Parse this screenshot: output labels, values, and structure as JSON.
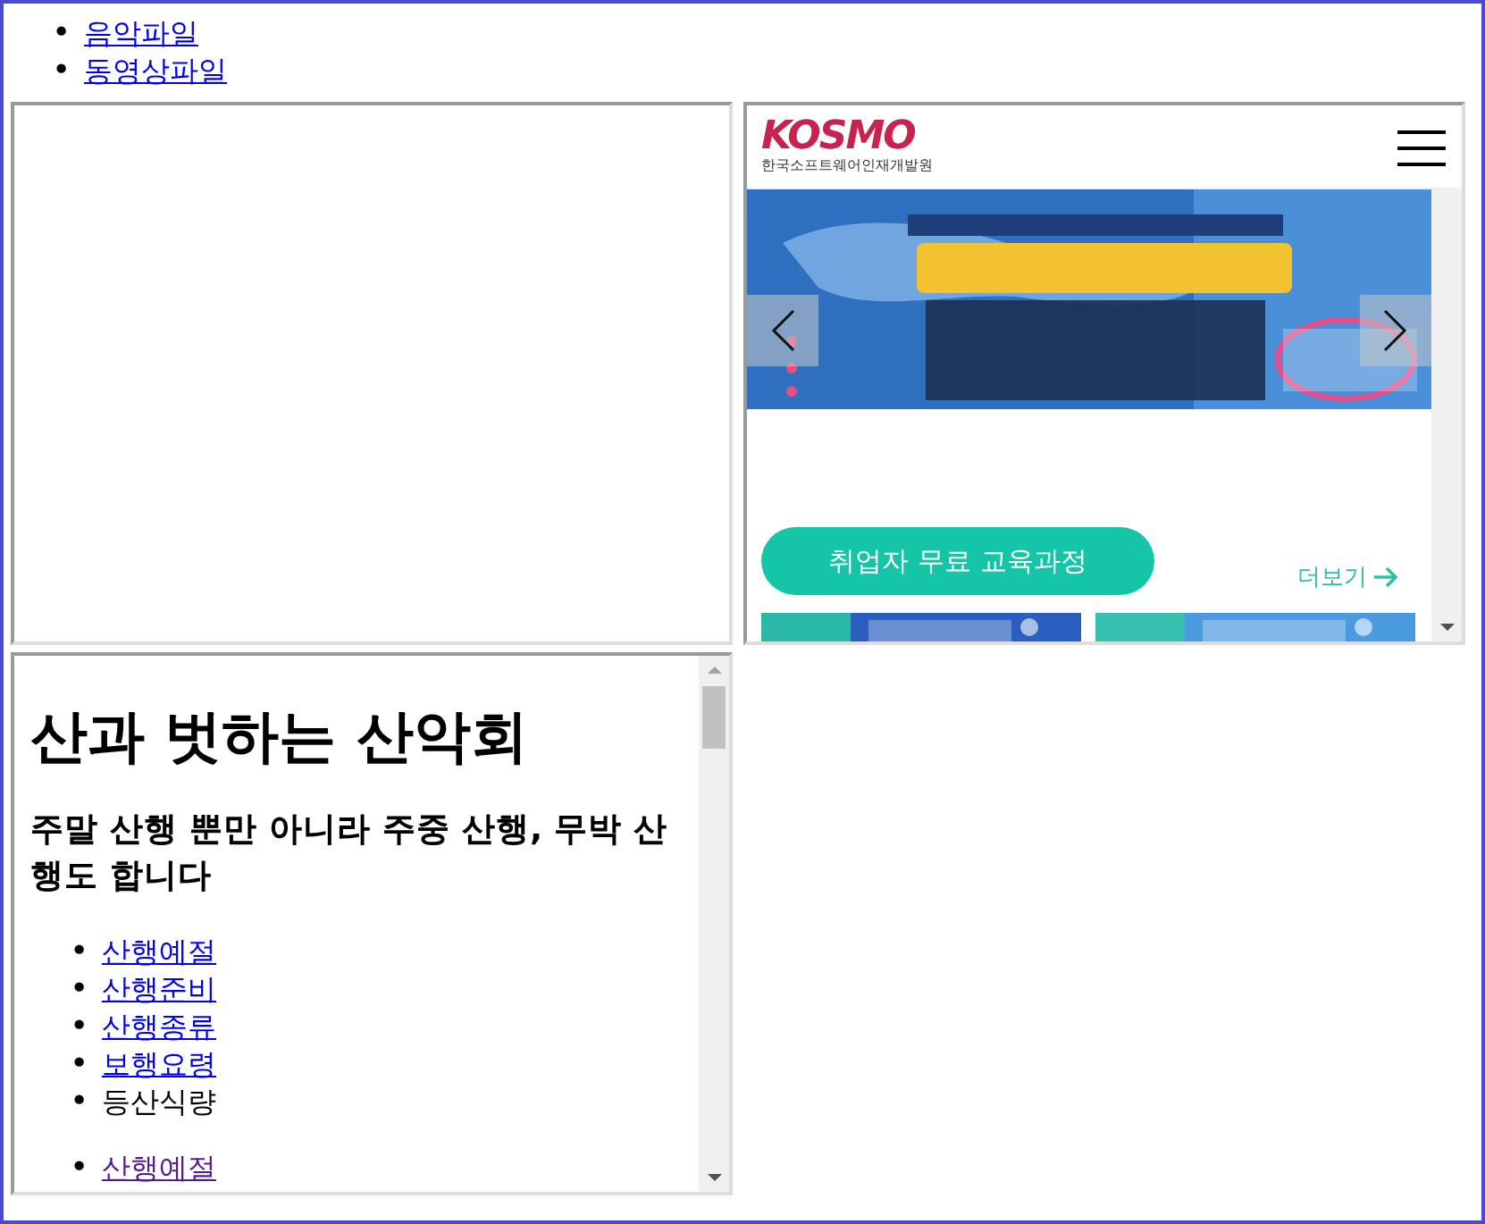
{
  "top_links": [
    {
      "marker": "•",
      "text": "음악파일"
    },
    {
      "marker": "•",
      "text": "동영상파일"
    }
  ],
  "frames": [
    {
      "kind": "empty"
    },
    {
      "kind": "site",
      "logo": "KOSMO",
      "logo_subtitle": "한국소프트웨어인재개발원",
      "course_button": "취업자 무료 교육과정",
      "more_link": "더보기"
    },
    {
      "kind": "article",
      "title": "산과 벗하는 산악회",
      "subtitle": "주말 산행 뿐만 아니라 주중 산행, 무박 산행도 합니다",
      "lists": [
        {
          "items": [
            {
              "marker": "•",
              "text": "산행예절",
              "kind": "link",
              "visited": false
            },
            {
              "marker": "•",
              "text": "산행준비",
              "kind": "link",
              "visited": false
            },
            {
              "marker": "•",
              "text": "산행종류",
              "kind": "link",
              "visited": false
            },
            {
              "marker": "•",
              "text": "보행요령",
              "kind": "link",
              "visited": false
            },
            {
              "marker": "•",
              "text": "등산식량",
              "kind": "text"
            }
          ]
        },
        {
          "items": [
            {
              "marker": "•",
              "text": "산행예절",
              "kind": "link",
              "visited": true
            }
          ]
        }
      ]
    }
  ]
}
